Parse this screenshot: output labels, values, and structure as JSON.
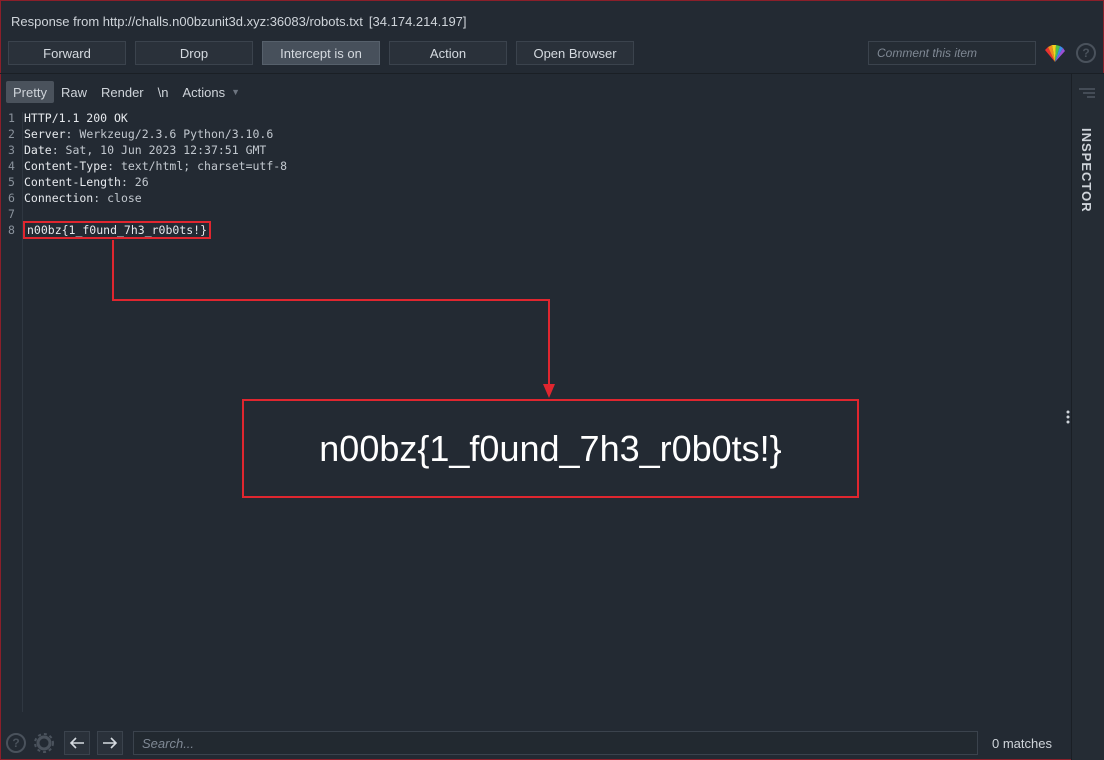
{
  "header": {
    "title": "Response from http://challs.n00bzunit3d.xyz:36083/robots.txt",
    "ip": "[34.174.214.197]"
  },
  "toolbar": {
    "forward": "Forward",
    "drop": "Drop",
    "intercept": "Intercept is on",
    "action": "Action",
    "open_browser": "Open Browser",
    "comment_placeholder": "Comment this item"
  },
  "view_tabs": {
    "pretty": "Pretty",
    "raw": "Raw",
    "render": "Render",
    "newline": "\\n",
    "actions": "Actions"
  },
  "response": {
    "lines": [
      {
        "num": "1",
        "key": "HTTP/1.1 200 OK",
        "val": ""
      },
      {
        "num": "2",
        "key": "Server",
        "val": ": Werkzeug/2.3.6 Python/3.10.6"
      },
      {
        "num": "3",
        "key": "Date",
        "val": ": Sat, 10 Jun 2023 12:37:51 GMT"
      },
      {
        "num": "4",
        "key": "Content-Type",
        "val": ": text/html; charset=utf-8"
      },
      {
        "num": "5",
        "key": "Content-Length",
        "val": ": 26"
      },
      {
        "num": "6",
        "key": "Connection",
        "val": ": close"
      },
      {
        "num": "7",
        "key": "",
        "val": ""
      },
      {
        "num": "8",
        "key": "n00bz{1_f0und_7h3_r0b0ts!}",
        "val": ""
      }
    ]
  },
  "callout": {
    "flag": "n00bz{1_f0und_7h3_r0b0ts!}"
  },
  "sidebar": {
    "inspector": "INSPECTOR"
  },
  "bottom": {
    "search_placeholder": "Search...",
    "matches": "0 matches"
  },
  "colors": {
    "highlight": "#e0262f",
    "background": "#232a33"
  }
}
